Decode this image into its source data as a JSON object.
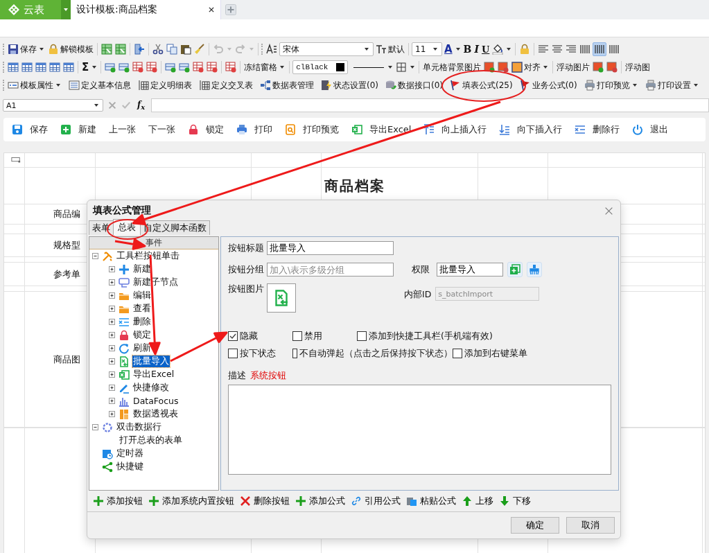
{
  "app_bar": {
    "brand": "云表",
    "tabs": [
      {
        "label": "设计模板:商品档案",
        "selected": true
      }
    ]
  },
  "toolbar_1": {
    "save": "保存",
    "unlock": "解锁模板",
    "font": "宋体",
    "default_size": "默认",
    "font_size": "11",
    "font_color": "A",
    "bold": "B",
    "italic": "I",
    "underline": "U"
  },
  "toolbar_2": {
    "sum": "Σ",
    "freeze": "冻结窗格",
    "color_value": "clBlack",
    "cell_bg_image": "单元格背景图片",
    "align": "对齐",
    "float_image": "浮动图片",
    "float_image_cut": "浮动图"
  },
  "toolbar_3": [
    {
      "label": "模板属性",
      "dropdown": true
    },
    {
      "label": "定义基本信息",
      "dropdown": false
    },
    {
      "label": "定义明细表",
      "dropdown": false
    },
    {
      "label": "定义交叉表",
      "dropdown": false
    },
    {
      "label": "数据表管理",
      "dropdown": false
    },
    {
      "label": "状态设置(0)",
      "dropdown": false
    },
    {
      "label": "数据接口(0)",
      "dropdown": false
    },
    {
      "label": "填表公式(25)",
      "dropdown": false
    },
    {
      "label": "业务公式(0)",
      "dropdown": false
    },
    {
      "label": "打印预览",
      "dropdown": true
    },
    {
      "label": "打印设置",
      "dropdown": true
    }
  ],
  "formula_bar": {
    "cell": "A1",
    "fx": "f$_{x}$"
  },
  "actions": [
    "保存",
    "新建",
    "上一张",
    "下一张",
    "锁定",
    "打印",
    "打印预览",
    "导出Excel",
    "向上插入行",
    "向下插入行",
    "删除行",
    "退出"
  ],
  "sheet": {
    "title": "商品档案",
    "labels": [
      "商品编",
      "规格型",
      "参考单",
      "商品图"
    ]
  },
  "dialog": {
    "title": "填表公式管理",
    "tabs": [
      {
        "label": "表单",
        "selected": false
      },
      {
        "label": "总表",
        "selected": true
      },
      {
        "label": "自定义脚本函数",
        "selected": false
      }
    ],
    "tree_header": "事件",
    "tree": [
      {
        "label": "工具栏按钮单击",
        "expanded": true,
        "selected": false,
        "children": [
          {
            "label": "新建",
            "expanded": false,
            "selected": false
          },
          {
            "label": "新建子节点",
            "expanded": false,
            "selected": false
          },
          {
            "label": "编辑",
            "expanded": false,
            "selected": false
          },
          {
            "label": "查看",
            "expanded": false,
            "selected": false
          },
          {
            "label": "删除",
            "expanded": false,
            "selected": false
          },
          {
            "label": "锁定",
            "expanded": false,
            "selected": false
          },
          {
            "label": "刷新",
            "expanded": false,
            "selected": false
          },
          {
            "label": "批量导入",
            "expanded": false,
            "selected": true
          },
          {
            "label": "导出Excel",
            "expanded": false,
            "selected": false
          },
          {
            "label": "快捷修改",
            "expanded": false,
            "selected": false
          },
          {
            "label": "DataFocus",
            "expanded": false,
            "selected": false
          },
          {
            "label": "数据透视表",
            "expanded": false,
            "selected": false
          }
        ]
      },
      {
        "label": "双击数据行",
        "expanded": true,
        "selected": false,
        "children": [
          {
            "label": "打开总表的表单",
            "selected": false
          }
        ]
      },
      {
        "label": "定时器",
        "selected": false
      },
      {
        "label": "快捷键",
        "selected": false
      }
    ],
    "form": {
      "title_label": "按钮标题",
      "title_value": "批量导入",
      "group_label": "按钮分组",
      "group_placeholder": "加入\\表示多级分组",
      "permission_label": "权限",
      "permission_value": "批量导入",
      "image_label": "按钮图片",
      "id_label": "内部ID",
      "id_value": "s_batchImport"
    },
    "checkbox_rows": [
      [
        {
          "label": "隐藏",
          "checked": true
        },
        {
          "label": "禁用",
          "checked": false
        },
        {
          "label": "添加到快捷工具栏(手机端有效)",
          "checked": false
        }
      ],
      [
        {
          "label": "按下状态",
          "checked": false
        },
        {
          "label": "不自动弹起（点击之后保持按下状态）",
          "checked": false
        },
        {
          "label": "添加到右键菜单",
          "checked": false
        }
      ]
    ],
    "description_label": "描述",
    "description_value": "系统按钮",
    "bottom_actions": [
      "添加按钮",
      "添加系统内置按钮",
      "删除按钮",
      "添加公式",
      "引用公式",
      "粘贴公式",
      "上移",
      "下移"
    ],
    "buttons": [
      "确定",
      "取消"
    ]
  }
}
